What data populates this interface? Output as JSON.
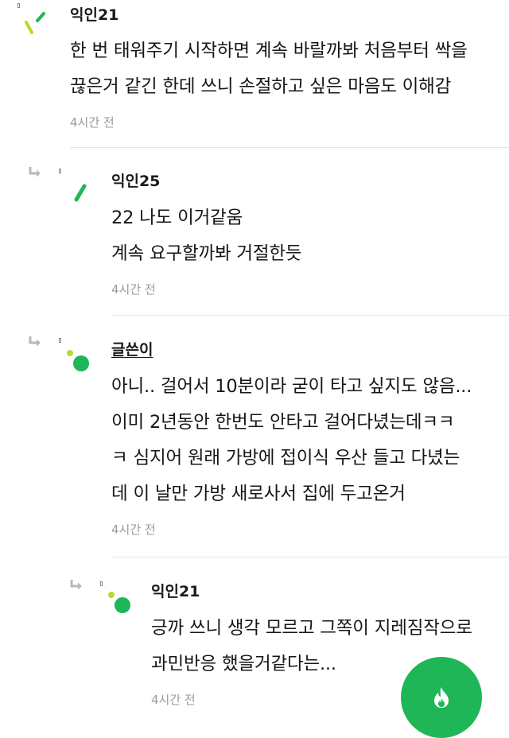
{
  "comments": [
    {
      "author": "익인21",
      "lines": [
        "한 번 태워주기 시작하면 계속 바랄까봐 처음부터 싹을",
        "끊은거 같긴 한데 쓰니 손절하고 싶은 마음도 이해감"
      ],
      "time": "4시간 전"
    },
    {
      "author": "익인25",
      "lines": [
        "22 나도 이거같움",
        "계속 요구할까봐 거절한듯"
      ],
      "time": "4시간 전"
    },
    {
      "author": "글쓴이",
      "lines": [
        "아니.. 걸어서 10분이라 굳이 타고 싶지도 않음...",
        "이미 2년동안 한번도 안타고 걸어다녔는데ㅋㅋ",
        "ㅋ 심지어 원래 가방에 접이식 우산 들고 다녔는",
        "데 이 날만 가방 새로사서 집에 두고온거"
      ],
      "time": "4시간 전"
    },
    {
      "author": "익인21",
      "lines": [
        "긍까 쓰니 생각 모르고 그쪽이 지레짐작으로",
        "과민반응 했을거같다는..."
      ],
      "time": "4시간 전"
    }
  ],
  "fab": {
    "icon": "flame-icon"
  },
  "colors": {
    "accent": "#1fb657",
    "avatar_lime": "#b5dc2c",
    "avatar_green": "#1fb657",
    "muted_text": "#9a9a9a"
  }
}
